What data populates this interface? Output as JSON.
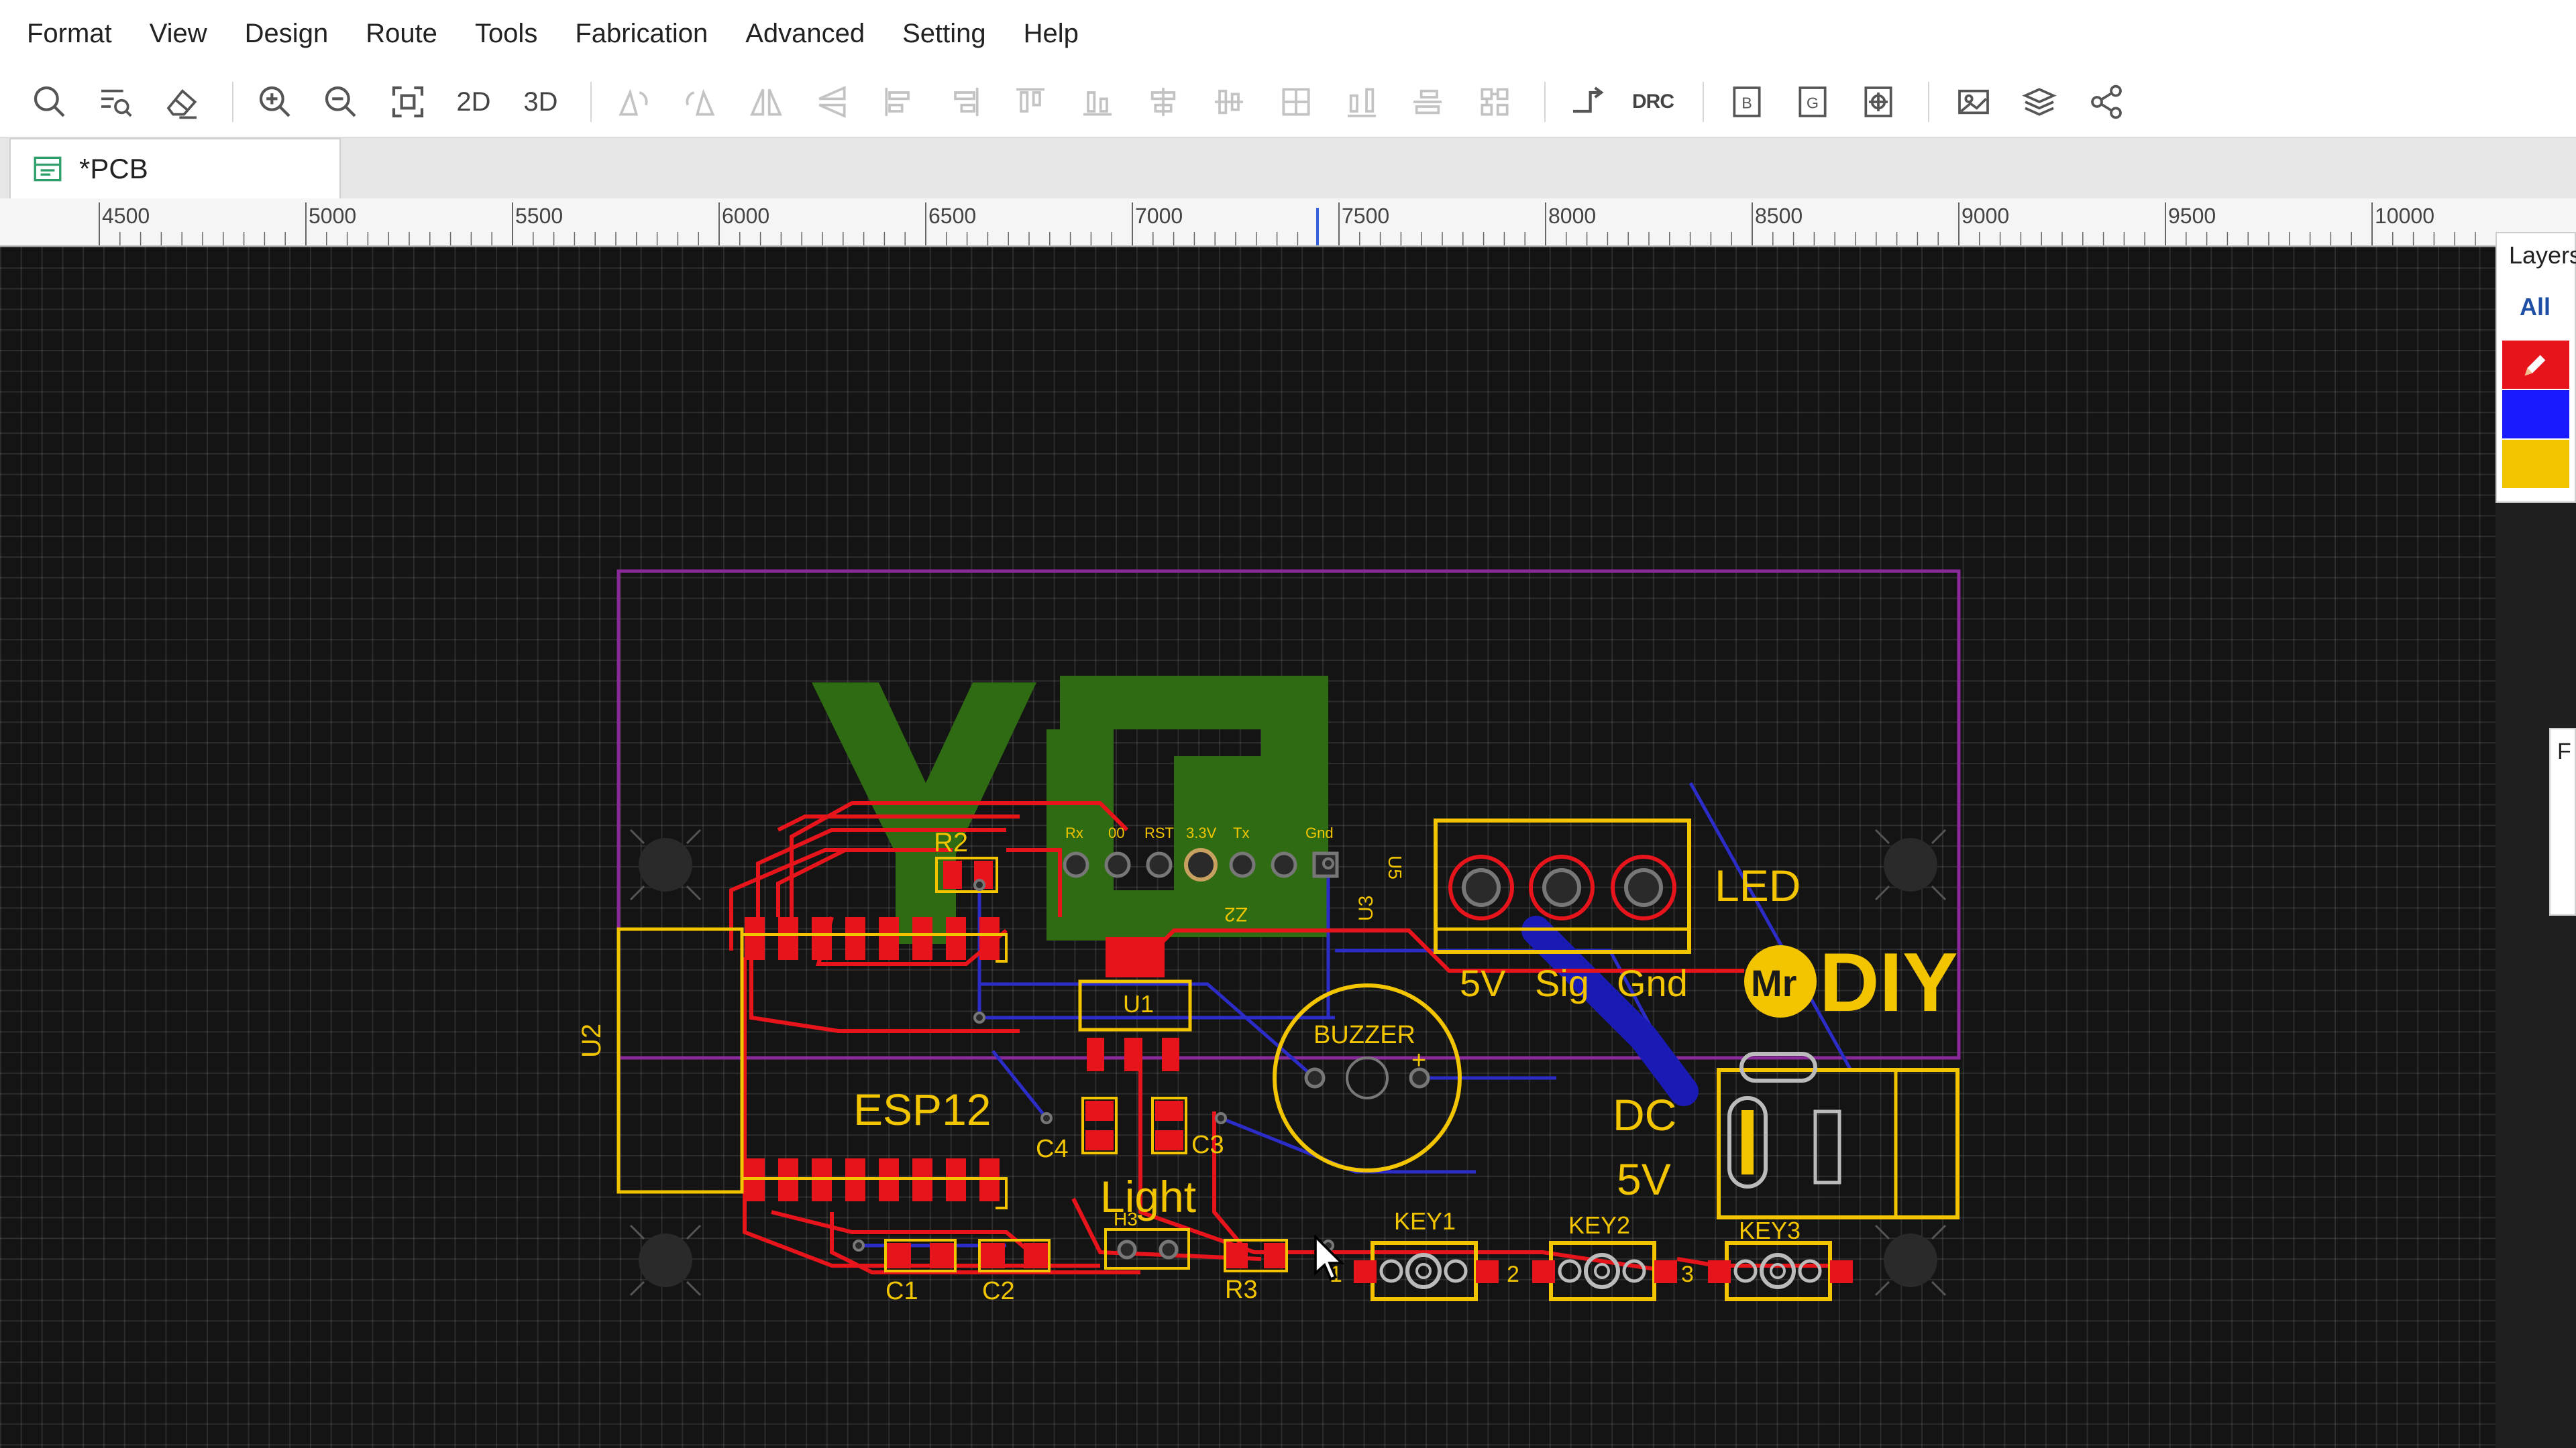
{
  "menu": [
    "Format",
    "View",
    "Design",
    "Route",
    "Tools",
    "Fabrication",
    "Advanced",
    "Setting",
    "Help"
  ],
  "toolbar": {
    "icons": [
      "search-icon",
      "find-list-icon",
      "eraser-icon",
      "zoom-in-icon",
      "zoom-out-icon",
      "fit-view-icon",
      "rotate-left-icon",
      "rotate-right-icon",
      "flip-horizontal-icon",
      "flip-vertical-icon",
      "align-left-icon",
      "align-right-icon",
      "align-top-icon",
      "align-bottom-icon",
      "align-center-h-icon",
      "align-center-v-icon",
      "align-grid-icon",
      "distribute-h-icon",
      "distribute-v-icon",
      "group-icon",
      "route-icon",
      "bom-icon",
      "gerber-icon",
      "pick-place-icon",
      "photo-view-icon",
      "layers-icon",
      "share-icon"
    ],
    "view_2d": "2D",
    "view_3d": "3D",
    "drc": "DRC"
  },
  "tab": {
    "label": "*PCB"
  },
  "ruler": [
    "4500",
    "5000",
    "5500",
    "6000",
    "6500",
    "7000",
    "7500",
    "8000",
    "8500",
    "9000",
    "9500",
    "10000"
  ],
  "layers": {
    "title": "Layers",
    "all": "All",
    "swatches": [
      "#e8141c",
      "#1a1aff",
      "#f2c500"
    ]
  },
  "side_panel_label": "F",
  "colors": {
    "top_copper": "#e8141c",
    "bottom_copper": "#2c2cc8",
    "silkscreen": "#f2c500",
    "outline": "#8a2a9a",
    "logo_fill": "#2e6b12"
  },
  "pcb": {
    "header_labels": [
      "Rx",
      "00",
      "RST",
      "3.3V",
      "Tx",
      "Gnd"
    ],
    "r2": "R2",
    "esp12": "ESP12",
    "u1": "U1",
    "c4": "C4",
    "c3": "C3",
    "light": "Light",
    "buzzer": "BUZZER",
    "buzzer_plus": "+",
    "u2": "U2",
    "u3": "U3",
    "u5": "U5",
    "z2": "Z2",
    "led": "LED",
    "pin_5v": "5V",
    "pin_sig": "Sig",
    "pin_gnd": "Gnd",
    "logo_mr": "Mr",
    "logo_diy": "DIY",
    "dc": "DC",
    "dc_5v": "5V",
    "key1": "KEY1",
    "key2": "KEY2",
    "key3": "KEY3",
    "c1": "C1",
    "c2": "C2",
    "r3": "R3",
    "h3": "H3",
    "key_num_1": "1",
    "key_num_2": "2",
    "key_num_3": "3"
  }
}
